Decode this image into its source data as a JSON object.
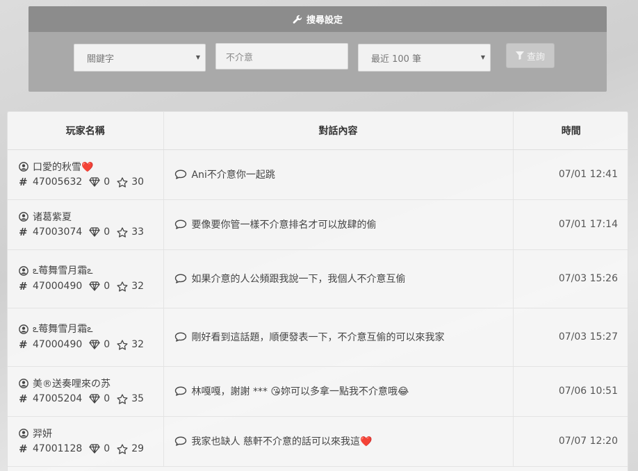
{
  "search": {
    "title": "搜尋設定",
    "field_select": "關鍵字",
    "keyword_placeholder": "不介意",
    "limit_select": "最近 100 筆",
    "query_label": "查詢"
  },
  "table": {
    "headers": [
      "玩家名稱",
      "對話內容",
      "時間"
    ],
    "rows": [
      {
        "name": "口愛的秋雪❤️",
        "id": "47005632",
        "gems": "0",
        "stars": "30",
        "message": "Ani不介意你一起跳",
        "time": "07/01 12:41"
      },
      {
        "name": "诸葛紫夏",
        "id": "47003074",
        "gems": "0",
        "stars": "33",
        "message": "要像要你管一樣不介意排名才可以放肆的偷",
        "time": "07/01 17:14"
      },
      {
        "name": "ఽ莓舞雪月霜ఽ",
        "id": "47000490",
        "gems": "0",
        "stars": "32",
        "message": "如果介意的人公頻跟我說一下，我個人不介意互偷",
        "time": "07/03 15:26"
      },
      {
        "name": "ఽ莓舞雪月霜ఽ",
        "id": "47000490",
        "gems": "0",
        "stars": "32",
        "message": "剛好看到這話題，順便發表一下，不介意互偷的可以來我家",
        "time": "07/03 15:27"
      },
      {
        "name": "美®送奏哩來の苏",
        "id": "47005204",
        "gems": "0",
        "stars": "35",
        "message": "林嘎嘎，謝謝 *** 😘妳可以多拿一點我不介意哦😂",
        "time": "07/06 10:51"
      },
      {
        "name": "羿妍",
        "id": "47001128",
        "gems": "0",
        "stars": "29",
        "message": "我家也缺人 慈軒不介意的話可以來我這❤️",
        "time": "07/07 12:20"
      }
    ]
  },
  "icons": {
    "search_header": "wrench-icon",
    "query": "filter-icon",
    "player": "user-circle-icon",
    "id": "hash-icon",
    "gems": "diamond-icon",
    "stars": "star-icon",
    "message": "comment-icon"
  }
}
